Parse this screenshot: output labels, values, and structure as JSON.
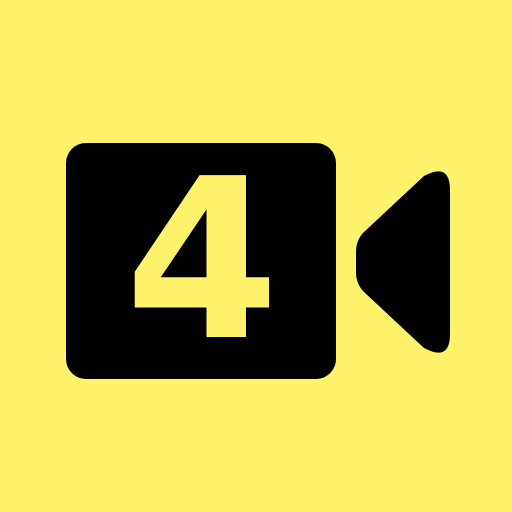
{
  "app_icon": {
    "icon": "video-camera-icon",
    "digit": "4",
    "colors": {
      "background": "#FFF36B",
      "camera": "#000000",
      "digit": "#FFF36B"
    }
  }
}
